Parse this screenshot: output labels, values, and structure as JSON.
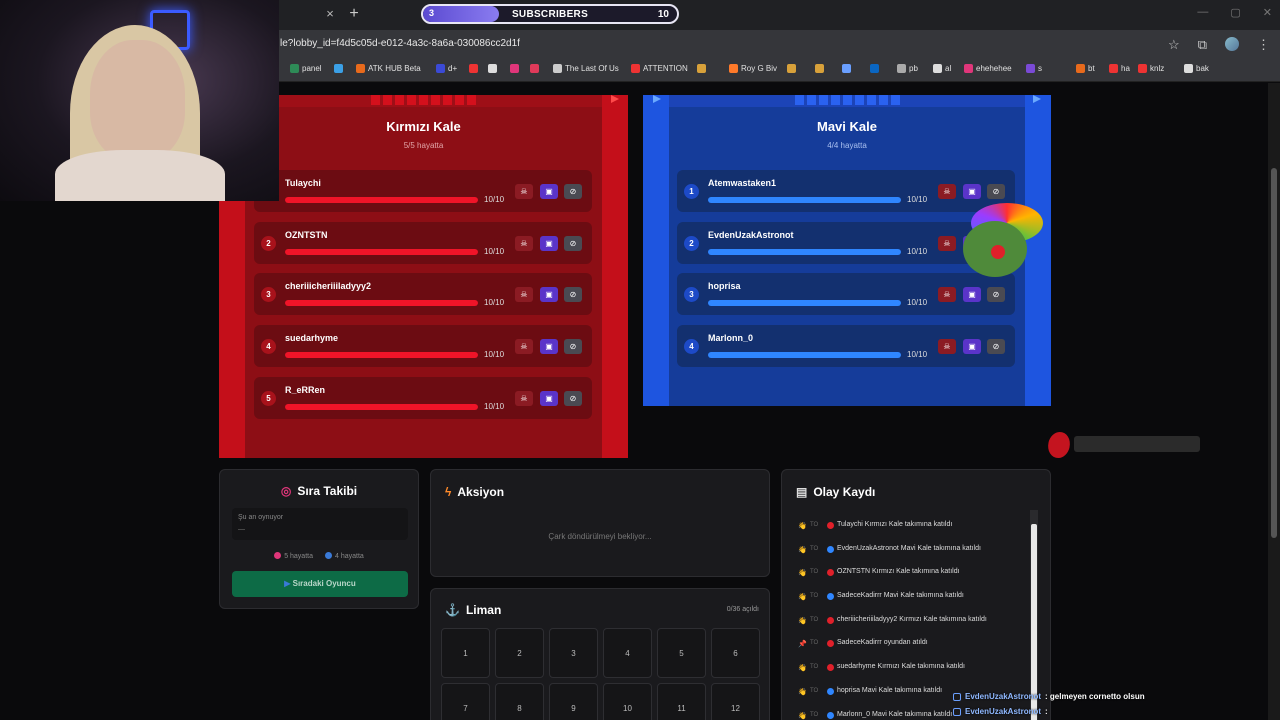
{
  "browser": {
    "url": "le?lobby_id=f4d5c05d-e012-4a3c-8a6a-030086cc2d1f",
    "tab_close_glyph": "×",
    "new_tab_glyph": "+",
    "bookmarks": [
      {
        "label": "panel",
        "color": "#2e8b57"
      },
      {
        "label": "",
        "color": "#3ba0e6"
      },
      {
        "label": "ATK HUB Beta",
        "color": "#e86a1c"
      },
      {
        "label": "d+",
        "color": "#3b4ad6"
      },
      {
        "label": "",
        "color": "#e33"
      },
      {
        "label": "",
        "color": "#ddd"
      },
      {
        "label": "",
        "color": "#e0367a"
      },
      {
        "label": "",
        "color": "#e03a5a"
      },
      {
        "label": "The Last Of Us",
        "color": "#ccc"
      },
      {
        "label": "ATTENTION",
        "color": "#e33"
      },
      {
        "label": "",
        "color": "#d8a13a"
      },
      {
        "label": "Roy G Biv",
        "color": "#ff7a2a"
      },
      {
        "label": "",
        "color": "#d8a13a"
      },
      {
        "label": "",
        "color": "#d8a13a"
      },
      {
        "label": "",
        "color": "#6a9fff"
      },
      {
        "label": "",
        "color": "#0a66c2"
      },
      {
        "label": "pb",
        "color": "#aaa"
      },
      {
        "label": "al",
        "color": "#ddd"
      },
      {
        "label": "ehehehee",
        "color": "#e0367a"
      },
      {
        "label": "s",
        "color": "#7a4ad6"
      },
      {
        "label": "bt",
        "color": "#e86a1c"
      },
      {
        "label": "ha",
        "color": "#e33"
      },
      {
        "label": "knlz",
        "color": "#e33"
      },
      {
        "label": "bak",
        "color": "#ddd"
      }
    ]
  },
  "subscribers": {
    "current": "3",
    "label": "SUBSCRIBERS",
    "goal": "10",
    "progress": 0.3
  },
  "teams": {
    "red": {
      "title": "Kırmızı Kale",
      "alive": "5/5 hayatta",
      "players": [
        {
          "num": "1",
          "name": "Tulaychi",
          "hp": "10/10",
          "hp_fraction": 1.0
        },
        {
          "num": "2",
          "name": "OZNTSTN",
          "hp": "10/10",
          "hp_fraction": 1.0
        },
        {
          "num": "3",
          "name": "cheriiicheriiiladyyy2",
          "hp": "10/10",
          "hp_fraction": 1.0
        },
        {
          "num": "4",
          "name": "suedarhyme",
          "hp": "10/10",
          "hp_fraction": 1.0
        },
        {
          "num": "5",
          "name": "R_eRRen",
          "hp": "10/10",
          "hp_fraction": 1.0
        }
      ]
    },
    "blue": {
      "title": "Mavi Kale",
      "alive": "4/4 hayatta",
      "players": [
        {
          "num": "1",
          "name": "Atemwastaken1",
          "hp": "10/10",
          "hp_fraction": 1.0
        },
        {
          "num": "2",
          "name": "EvdenUzakAstronot",
          "hp": "10/10",
          "hp_fraction": 1.0
        },
        {
          "num": "3",
          "name": "hoprisa",
          "hp": "10/10",
          "hp_fraction": 1.0
        },
        {
          "num": "4",
          "name": "Marlonn_0",
          "hp": "10/10",
          "hp_fraction": 1.0
        }
      ]
    }
  },
  "turn_panel": {
    "title": "Sıra Takibi",
    "now_label": "Şu an oynuyor",
    "now_value": "—",
    "red_alive": "5 hayatta",
    "blue_alive": "4 hayatta",
    "next_button": "Sıradaki Oyuncu"
  },
  "action_panel": {
    "title": "Aksiyon",
    "message": "Çark döndürülmeyi bekliyor..."
  },
  "harbor_panel": {
    "title": "Liman",
    "count": "0/36 açıldı",
    "cells": [
      "1",
      "2",
      "3",
      "4",
      "5",
      "6",
      "7",
      "8",
      "9",
      "10",
      "11",
      "12"
    ]
  },
  "log_panel": {
    "title": "Olay Kaydı",
    "entries": [
      {
        "icon": "👋",
        "tag": "TO",
        "team": "red",
        "text": "Tulaychi Kırmızı Kale takımına katıldı"
      },
      {
        "icon": "👋",
        "tag": "TO",
        "team": "blue",
        "text": "EvdenUzakAstronot Mavi Kale takımına katıldı"
      },
      {
        "icon": "👋",
        "tag": "TO",
        "team": "red",
        "text": "OZNTSTN Kırmızı Kale takımına katıldı"
      },
      {
        "icon": "👋",
        "tag": "TO",
        "team": "blue",
        "text": "SadeceKadirrr Mavi Kale takımına katıldı"
      },
      {
        "icon": "👋",
        "tag": "TO",
        "team": "red",
        "text": "cheriiicheriiiladyyy2 Kırmızı Kale takımına katıldı"
      },
      {
        "icon": "📌",
        "tag": "TO",
        "team": "kick",
        "text": "SadeceKadirrr oyundan atıldı"
      },
      {
        "icon": "👋",
        "tag": "TO",
        "team": "red",
        "text": "suedarhyme Kırmızı Kale takımına katıldı"
      },
      {
        "icon": "👋",
        "tag": "TO",
        "team": "blue",
        "text": "hoprisa Mavi Kale takımına katıldı"
      },
      {
        "icon": "👋",
        "tag": "TO",
        "team": "blue",
        "text": "Marlonn_0 Mavi Kale takımına katıldı"
      }
    ]
  },
  "chat": [
    {
      "user": "EvdenUzakAstronot",
      "message": ": gelmeyen cornetto olsun"
    },
    {
      "user": "EvdenUzakAstronot",
      "message": ":"
    }
  ],
  "colors": {
    "red": "#e0202a",
    "blue": "#2f86ff",
    "kick": "#e0202a"
  }
}
